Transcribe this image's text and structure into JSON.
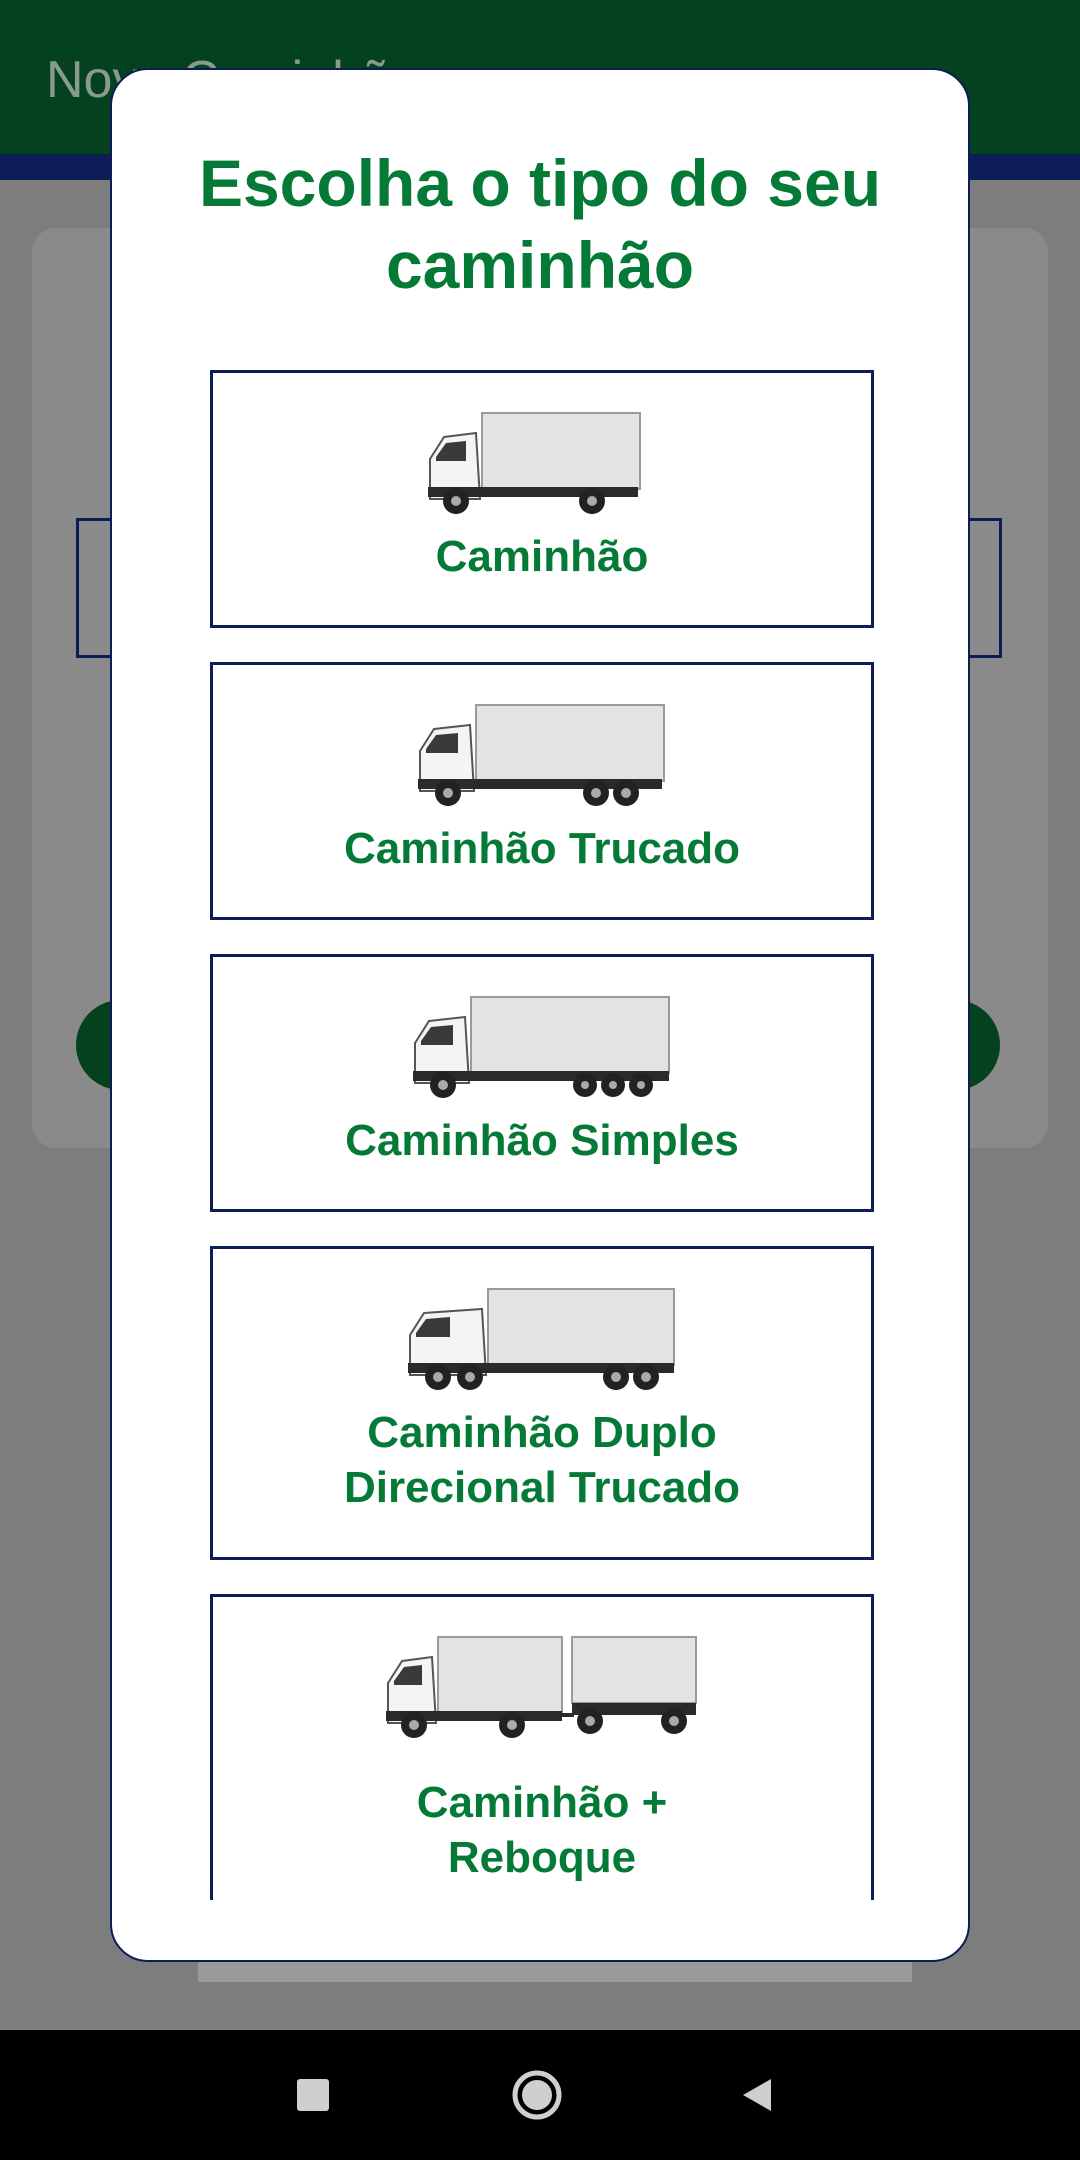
{
  "app": {
    "title": "Novo Caminhão"
  },
  "modal": {
    "title": "Escolha o tipo do seu caminhão",
    "options": [
      {
        "label": "Caminhão",
        "icon": "truck-icon"
      },
      {
        "label": "Caminhão Trucado",
        "icon": "truck-trucado-icon"
      },
      {
        "label": "Caminhão Simples",
        "icon": "truck-simples-icon"
      },
      {
        "label": "Caminhão Duplo Direcional Trucado",
        "icon": "truck-duplo-direcional-icon"
      },
      {
        "label": "Caminhão + Reboque",
        "icon": "truck-reboque-icon"
      }
    ]
  },
  "navigation": {
    "recents": "square-icon",
    "home": "circle-icon",
    "back": "triangle-back-icon"
  },
  "colors": {
    "primary_green": "#047a36",
    "dark_green": "#04411e",
    "navy": "#0b1c56"
  }
}
